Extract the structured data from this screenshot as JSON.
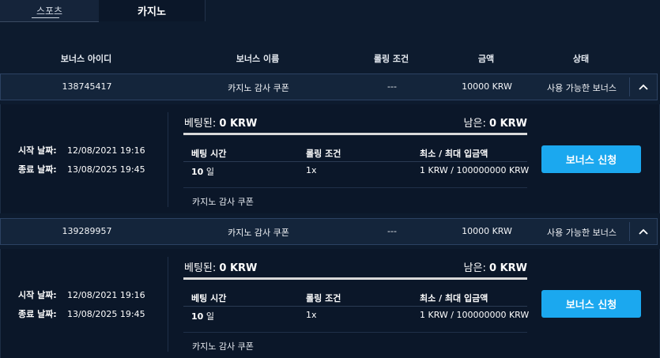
{
  "tabs": {
    "sports": "스포츠",
    "casino": "카지노"
  },
  "headers": {
    "id": "보너스 아이디",
    "name": "보너스 이름",
    "rolling": "롤링 조건",
    "amount": "금액",
    "status": "상태"
  },
  "labels": {
    "start": "시작 날짜:",
    "end": "종료 날짜:",
    "bet": "베팅된:",
    "remaining": "남은:",
    "col_time": "베팅 시간",
    "col_rolling": "롤링 조건",
    "col_minmax": "최소 / 최대 입금액",
    "day_unit": "일",
    "claim_button": "보너스 신청"
  },
  "bonuses": [
    {
      "id": "138745417",
      "name": "카지노 감사 쿠폰",
      "rolling": "---",
      "amount": "10000 KRW",
      "status": "사용 가능한 보너스",
      "start": "12/08/2021 19:16",
      "end": "13/08/2025 19:45",
      "bet": "0 KRW",
      "remaining": "0 KRW",
      "days": "10",
      "rolling_mult": "1x",
      "minmax": "1 KRW / 100000000 KRW",
      "progress": 1.0
    },
    {
      "id": "139289957",
      "name": "카지노 감사 쿠폰",
      "rolling": "---",
      "amount": "10000 KRW",
      "status": "사용 가능한 보너스",
      "start": "12/08/2021 19:16",
      "end": "13/08/2025 19:45",
      "bet": "0 KRW",
      "remaining": "0 KRW",
      "days": "10",
      "rolling_mult": "1x",
      "minmax": "1 KRW / 100000000 KRW",
      "progress": 1.0
    }
  ]
}
